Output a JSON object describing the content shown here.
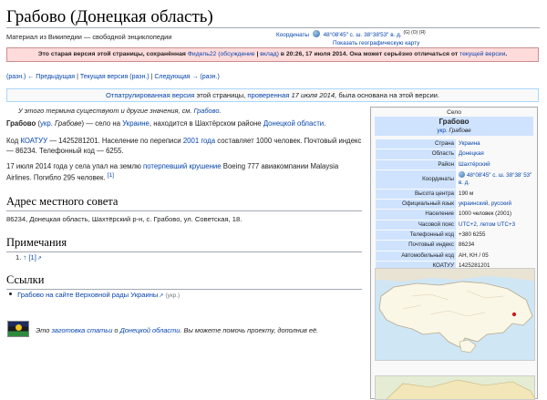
{
  "page": {
    "title": "Грабово (Донецкая область)",
    "tagline": "Материал из Википедии — свободной энциклопедии",
    "coords_label": "Координаты",
    "coords_value": "48°08′45″ с. ш. 38°38′53″ в. д.",
    "coords_sup": "(G) (O) (Я)",
    "map_link": "Показать географическую карту"
  },
  "old_revision": {
    "pre": "Это старая версия этой страницы, сохранённая",
    "user": "Фидель22",
    "talk": "(обсуждение",
    "contrib": "вклад)",
    "mid": "в 20:26, 17 июля 2014. Она может серьёзно отличаться от",
    "current": "текущей версии",
    "end": "."
  },
  "diff_nav": {
    "prev_diff": "(разн.)",
    "prev": "← Предыдущая",
    "sep1": "|",
    "current": "Текущая версия",
    "cur_diff": "(разн.)",
    "sep2": "|",
    "next": "Следующая →",
    "next_diff": "(разн.)"
  },
  "patrolled": {
    "link1": "Отпатрулированная версия",
    "mid": "этой страницы,",
    "link2": "проверенная",
    "date": "17 июля 2014,",
    "end": "была основана на этой версии."
  },
  "hatnote": {
    "text": "У этого термина существуют и другие значения, см.",
    "link": "Грабово",
    "end": "."
  },
  "intro": {
    "bold": "Грабово",
    "lang": "укр.",
    "native": "Грабове",
    "t1": ") — село на",
    "country": "Украине",
    "t2": ", находится в Шахтёрском районе",
    "region": "Донецкой области",
    "t3": "."
  },
  "stats": {
    "t1": "Код",
    "koatuu": "КОАТУУ",
    "t2": "— 1425281201. Население по переписи",
    "census": "2001 года",
    "t3": "составляет 1000 человек. Почтовый индекс — 86234. Телефонный код — 6255."
  },
  "crash": {
    "t1": "17 июля 2014 года у села упал на землю",
    "link": "потерпевший крушение",
    "t2": "Boeing 777 авиакомпании Malaysia Airlines. Погибло 295 человек.",
    "ref": "[1]"
  },
  "sections": {
    "address_title": "Адрес местного совета",
    "address_text": "86234, Донецкая область, Шахтёрский р-н, с. Грабово, ул. Советская, 18.",
    "notes_title": "Примечания",
    "note_1": "1.",
    "note_1_arrow": "↑",
    "note_1_link": "[1]",
    "links_title": "Ссылки",
    "link_1": "Грабово на сайте Верховной рады Украины",
    "link_1_lang": "(укр.)"
  },
  "stub": {
    "t1": "Это",
    "stub_link": "заготовка статьи",
    "t2": "о",
    "region": "Донецкой области",
    "t3": ". Вы можете помочь проекту, дополнив её."
  },
  "infobox": {
    "caption": "Село",
    "title": "Грабово",
    "subtitle_lang": "укр.",
    "subtitle": "Грабове",
    "rows": [
      {
        "k": "Страна",
        "v": "Украина"
      },
      {
        "k": "Область",
        "v": "Донецкая"
      },
      {
        "k": "Район",
        "v": "Шахтёрский"
      },
      {
        "k": "Координаты",
        "v": "48°08′45″ с. ш. 38°38′ 53″ в. д."
      },
      {
        "k": "Высота центра",
        "v": "190 м"
      },
      {
        "k": "Официальный язык",
        "v": "украинский, русский"
      },
      {
        "k": "Население",
        "v": "1000 человек (2001)"
      },
      {
        "k": "Часовой пояс",
        "v": "UTC+2, летом UTC+3"
      },
      {
        "k": "Телефонный код",
        "v": "+380 6255"
      },
      {
        "k": "Почтовый индекс",
        "v": "86234"
      },
      {
        "k": "Автомобильный код",
        "v": "AH, KH / 05"
      },
      {
        "k": "КОАТУУ",
        "v": "1425281201"
      }
    ]
  },
  "colors": {
    "link": "#0645ad",
    "old_rev_bg": "#ffdbdb",
    "infobox_label_bg": "#cfe3ff",
    "map_marker": "#d11a1a"
  }
}
